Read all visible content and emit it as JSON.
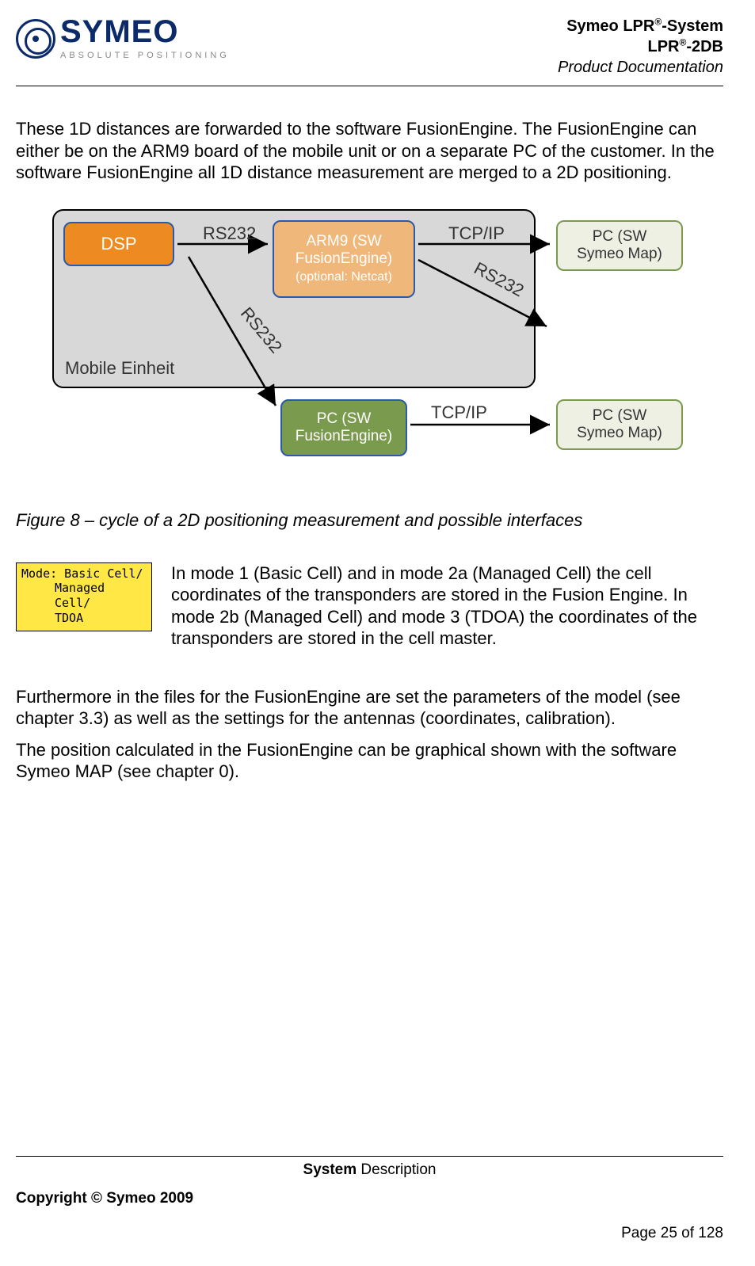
{
  "header": {
    "logo_name": "SYMEO",
    "logo_tag": "ABSOLUTE POSITIONING",
    "title_line1_a": "Symeo LPR",
    "title_line1_b": "-System",
    "title_line2_a": "LPR",
    "title_line2_b": "-2DB",
    "title_line3": "Product Documentation",
    "sup": "®"
  },
  "body": {
    "p1": "These 1D distances are forwarded to the software FusionEngine. The FusionEngine can either be on the ARM9 board of the mobile unit or on a separate PC of the customer. In the software FusionEngine all 1D distance measurement are merged to a 2D positioning.",
    "caption": "Figure 8 – cycle of a 2D positioning measurement and possible interfaces",
    "mode_badge_l1": "Mode: Basic Cell/",
    "mode_badge_l2": "Managed Cell/",
    "mode_badge_l3": "TDOA",
    "mode_text": "In mode 1 (Basic Cell) and in mode 2a (Managed Cell) the cell coordinates of the transponders are stored in the Fusion Engine. In mode 2b (Managed Cell) and mode 3 (TDOA) the coordinates of the transponders are stored in the cell master.",
    "p2": "Furthermore in the files for the FusionEngine are set the parameters of the model (see chapter 3.3) as well as the settings for the antennas (coordinates, calibration).",
    "p3": "The position calculated in the FusionEngine can be graphical shown with the software Symeo MAP (see chapter 0)."
  },
  "diagram": {
    "mobile_label": "Mobile Einheit",
    "dsp": "DSP",
    "arm9_l1": "ARM9 (SW",
    "arm9_l2": "FusionEngine)",
    "arm9_opt": "(optional: Netcat)",
    "pcmap_l1": "PC (SW",
    "pcmap_l2": "Symeo Map)",
    "pcfe_l1": "PC (SW",
    "pcfe_l2": "FusionEngine)",
    "rs232": "RS232",
    "tcpip": "TCP/IP"
  },
  "footer": {
    "section_bold": "System",
    "section_rest": " Description",
    "copyright": "Copyright © Symeo 2009",
    "page": "Page 25 of 128"
  }
}
